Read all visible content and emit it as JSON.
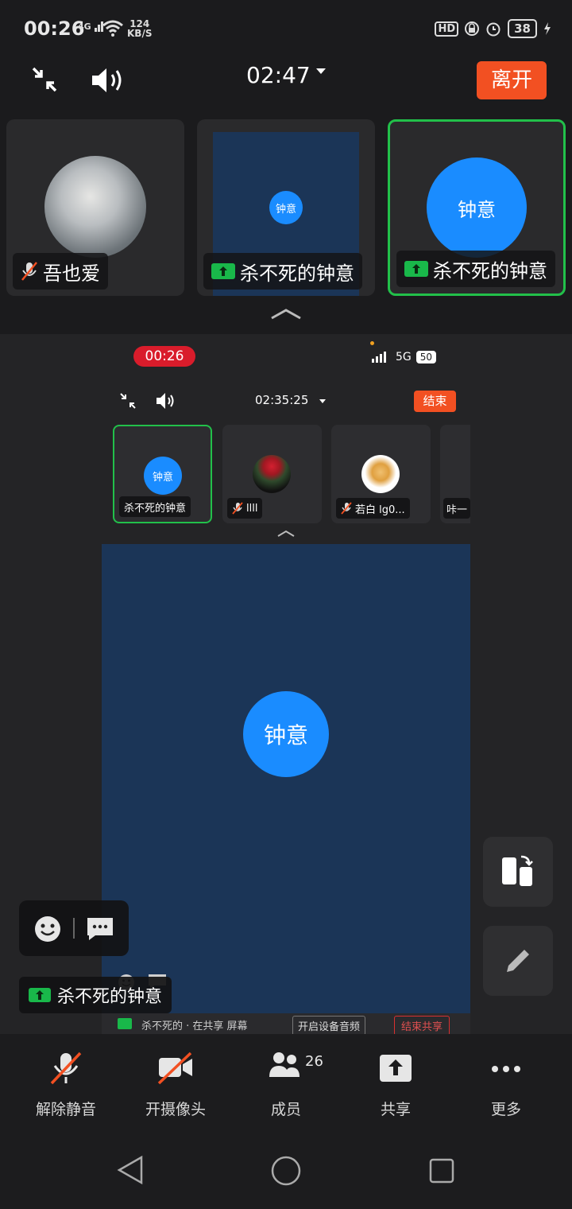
{
  "status_bar": {
    "time": "00:26",
    "signal_label": "4G",
    "speed_value": "124",
    "speed_unit": "KB/S",
    "hd_label": "HD",
    "battery": "38"
  },
  "meeting": {
    "duration": "02:47",
    "leave_label": "离开"
  },
  "thumbnails": [
    {
      "name": "吾也爱",
      "muted": true
    },
    {
      "name": "杀不死的钟意",
      "avatar_text": "钟意",
      "sharing": true
    },
    {
      "name": "杀不死的钟意",
      "avatar_text": "钟意",
      "sharing": true,
      "active": true
    }
  ],
  "shared_screen": {
    "status_time": "00:26",
    "network": "5G",
    "battery": "50",
    "duration": "02:35:25",
    "end_label": "结束",
    "thumbnails": [
      {
        "name": "杀不死的钟意",
        "avatar_text": "钟意",
        "active": true
      },
      {
        "name": "llll",
        "muted": true
      },
      {
        "name": "若白 lg0...",
        "muted": true
      },
      {
        "name": "咔一"
      }
    ],
    "main_avatar_text": "钟意",
    "bottom_strip_text": "杀不死的 · 在共享 屏幕",
    "bottom_btn_1": "开启设备音频",
    "bottom_btn_2": "结束共享"
  },
  "presenter_tag": "杀不死的钟意",
  "toolbar": {
    "unmute_label": "解除静音",
    "camera_label": "开摄像头",
    "members_label": "成员",
    "members_count": "26",
    "share_label": "共享",
    "more_label": "更多"
  },
  "colors": {
    "accent_blue": "#1a8cff",
    "leave_red": "#f25022",
    "active_green": "#22c04a"
  }
}
